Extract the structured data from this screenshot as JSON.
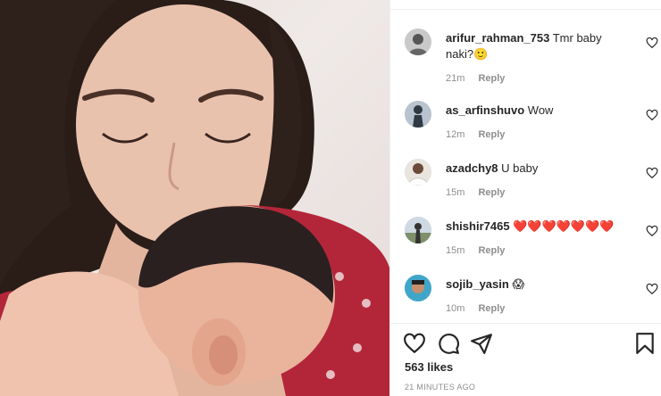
{
  "post": {
    "photo_description_icon": "photo"
  },
  "comments": [
    {
      "username": "arifur_rahman_753",
      "text": "Tmr baby naki?🙂",
      "time": "21m",
      "reply_label": "Reply",
      "avatar_icon": "avatar-icon"
    },
    {
      "username": "as_arfinshuvo",
      "text": "Wow",
      "time": "12m",
      "reply_label": "Reply",
      "avatar_icon": "avatar-icon"
    },
    {
      "username": "azadchy8",
      "text": "U baby",
      "time": "15m",
      "reply_label": "Reply",
      "avatar_icon": "avatar-icon"
    },
    {
      "username": "shishir7465",
      "text": "❤️❤️❤️❤️❤️❤️❤️",
      "time": "15m",
      "reply_label": "Reply",
      "avatar_icon": "avatar-icon"
    },
    {
      "username": "sojib_yasin",
      "text": "😱",
      "time": "10m",
      "reply_label": "Reply",
      "avatar_icon": "avatar-icon"
    }
  ],
  "actions": {
    "like_icon": "heart-icon",
    "comment_icon": "comment-icon",
    "share_icon": "share-icon",
    "save_icon": "bookmark-icon"
  },
  "likes_label": "563 likes",
  "time_ago": "21 MINUTES AGO",
  "colors": {
    "text": "#262626",
    "muted": "#8e8e8e",
    "border": "#efefef",
    "heart_red": "#ed4956"
  }
}
